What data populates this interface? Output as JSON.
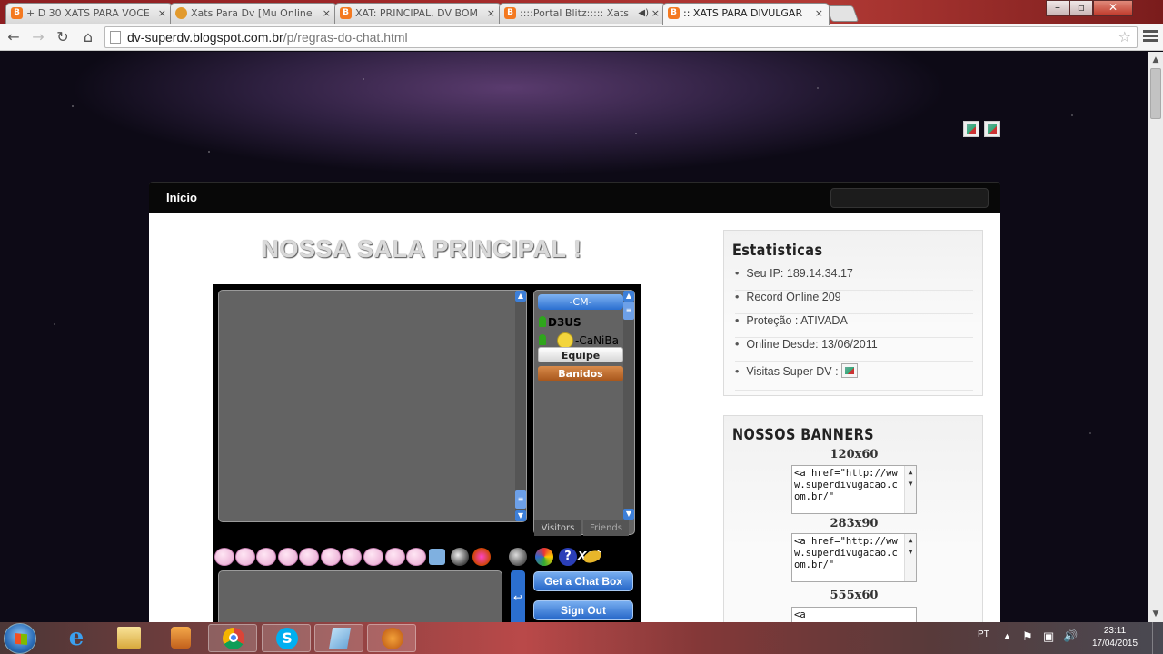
{
  "browser": {
    "tabs": [
      {
        "title": "+ D 30 XATS PARA VOCE",
        "icon": "blogger-icon",
        "active": false
      },
      {
        "title": "Xats Para Dv [Mu Online]",
        "icon": "xat-icon",
        "active": false
      },
      {
        "title": "XAT: PRINCIPAL, DV BOM",
        "icon": "blogger-icon",
        "active": false
      },
      {
        "title": "::::Portal Blitz::::: Xats L",
        "icon": "blogger-icon",
        "active": false
      },
      {
        "title": ":: XATS PARA DIVULGAR",
        "icon": "blogger-icon",
        "active": true
      }
    ],
    "close_glyph": "×",
    "favicon_letter": "B",
    "url_domain": "dv-superdv.blogspot.com.br",
    "url_path": "/p/regras-do-chat.html",
    "window_controls": {
      "minimize": "–",
      "maximize": "▫",
      "close": "✕"
    }
  },
  "nav": {
    "home_label": "Início"
  },
  "post": {
    "title": "NOSSA SALA PRINCIPAL !"
  },
  "xat": {
    "main_group": "-CM-",
    "users": [
      {
        "name": "D3US"
      },
      {
        "name": "-CaNiBa"
      }
    ],
    "groups": [
      "Equipe",
      "Banidos"
    ],
    "tabs": [
      "Visitors",
      "Friends"
    ],
    "logo": "xat",
    "send_glyph": "↩",
    "buttons": {
      "chat_box": "Get a Chat Box",
      "sign_out": "Sign Out"
    }
  },
  "stats_widget": {
    "title": "Estatisticas",
    "items": [
      "Seu IP: 189.14.34.17",
      "Record Online 209",
      "Proteção : ATIVADA",
      "Online Desde: 13/06/2011",
      "Visitas Super DV :"
    ]
  },
  "banners_widget": {
    "title": "NOSSOS BANNERS",
    "banners": [
      {
        "size": "120x60",
        "code": "<a href=\"http://www.superdivugacao.com.br/\""
      },
      {
        "size": "283x90",
        "code": "<a href=\"http://www.superdivugacao.com.br/\""
      },
      {
        "size": "555x60",
        "code": "<a"
      }
    ]
  },
  "taskbar": {
    "apps": [
      "internet-explorer-icon",
      "file-explorer-icon",
      "media-player-icon",
      "chrome-icon",
      "skype-icon",
      "notepad-icon",
      "xat-icon"
    ],
    "language": "PT",
    "time": "23:11",
    "date": "17/04/2015"
  },
  "colors": {
    "tab_bar": "#a42a2a",
    "xat_blue": "#2b6fd0",
    "banidos": "#c46a23",
    "page_bg": "#0b0912"
  }
}
